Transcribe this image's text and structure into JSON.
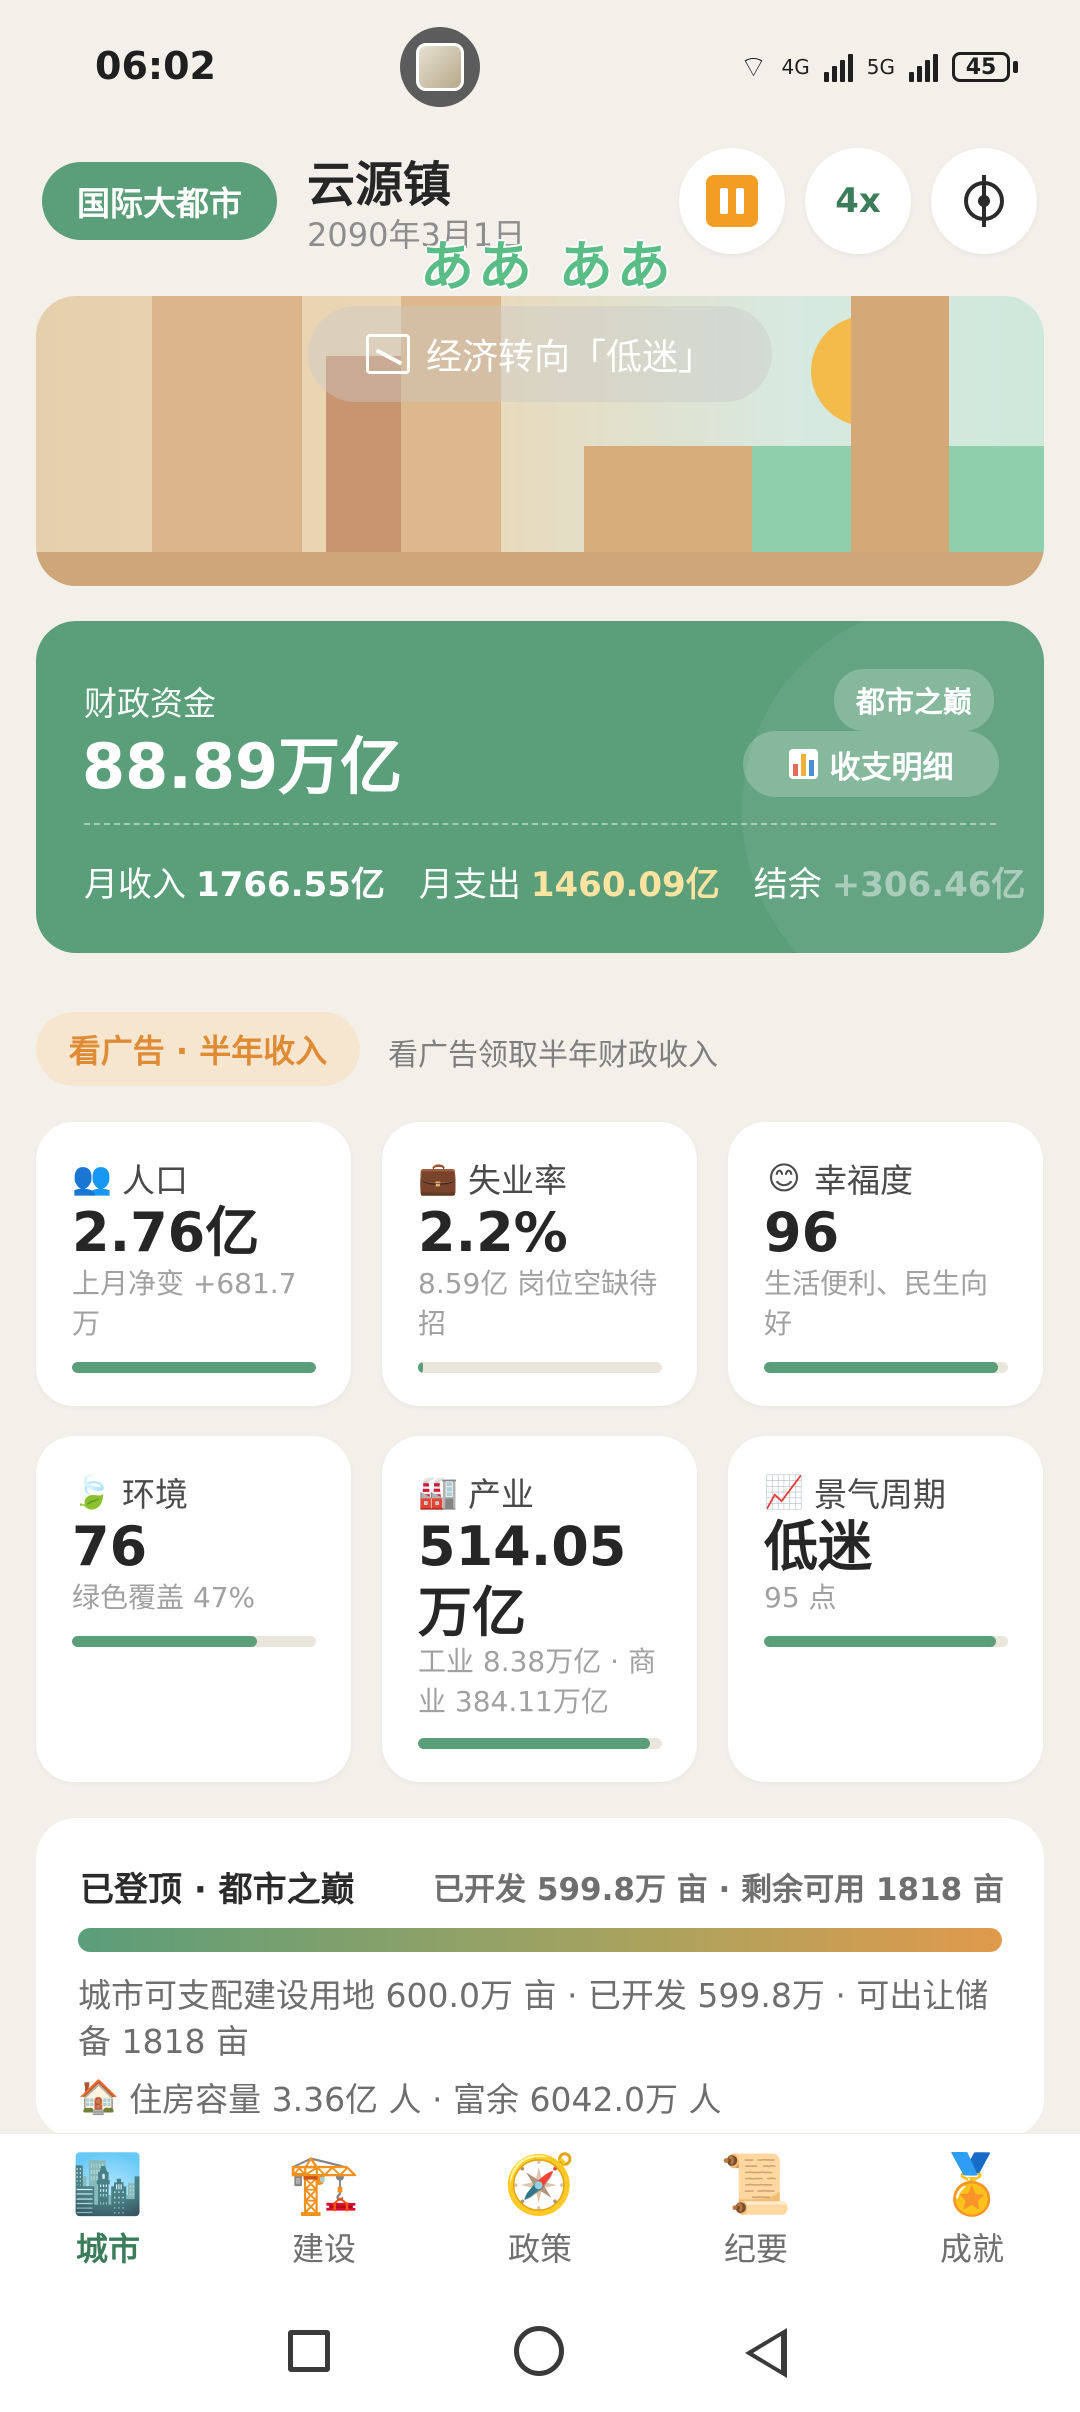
{
  "status_bar": {
    "time": "06:02",
    "net1": "4G",
    "net2": "5G",
    "battery": "45"
  },
  "header": {
    "rank": "国际大都市",
    "city": "云源镇",
    "date": "2090年3月1日",
    "floating_text": "ああ ああ",
    "speed": "4x"
  },
  "banner": {
    "toast": "经济转向「低迷」"
  },
  "finance": {
    "label": "财政资金",
    "value": "88.89万亿",
    "tag": "都市之巅",
    "detail_button": "收支明细",
    "income_label": "月收入",
    "income": "1766.55亿",
    "expense_label": "月支出",
    "expense": "1460.09亿",
    "balance_label": "结余",
    "balance": "+306.46亿"
  },
  "ad": {
    "button": "看广告 · 半年收入",
    "desc": "看广告领取半年财政收入"
  },
  "stats": {
    "population": {
      "icon": "people-icon",
      "title": "人口",
      "value": "2.76亿",
      "sub": "上月净变 +681.7万",
      "progress": 1.0
    },
    "unemployment": {
      "icon": "briefcase-icon",
      "title": "失业率",
      "value": "2.2%",
      "sub": "8.59亿 岗位空缺待招",
      "progress": 0.02
    },
    "happiness": {
      "icon": "smile-icon",
      "title": "幸福度",
      "value": "96",
      "sub": "生活便利、民生向好",
      "progress": 0.96
    },
    "environment": {
      "icon": "leaf-icon",
      "title": "环境",
      "value": "76",
      "sub": "绿色覆盖 47%",
      "progress": 0.76
    },
    "industry": {
      "icon": "factory-icon",
      "title": "产业",
      "value": "514.05万亿",
      "sub": "工业 8.38万亿 · 商业 384.11万亿",
      "progress": 0.95
    },
    "cycle": {
      "icon": "trend-chart-icon",
      "title": "景气周期",
      "value": "低迷",
      "sub": "95 点",
      "progress": 0.95
    }
  },
  "land": {
    "title": "已登顶 · 都市之巅",
    "right": "已开发 599.8万 亩 · 剩余可用 1818 亩",
    "progress": 0.9997,
    "text": "城市可支配建设用地 600.0万 亩 · 已开发 599.8万 · 可出让储备 1818 亩",
    "housing": "住房容量 3.36亿 人 · 富余 6042.0万 人"
  },
  "nav": [
    {
      "label": "城市",
      "icon": "city-icon",
      "glyph": "🏙️",
      "active": true
    },
    {
      "label": "建设",
      "icon": "crane-icon",
      "glyph": "🏗️",
      "active": false
    },
    {
      "label": "政策",
      "icon": "compass-icon",
      "glyph": "🧭",
      "active": false
    },
    {
      "label": "纪要",
      "icon": "scroll-icon",
      "glyph": "📜",
      "active": false
    },
    {
      "label": "成就",
      "icon": "medal-icon",
      "glyph": "🏅",
      "active": false
    }
  ]
}
